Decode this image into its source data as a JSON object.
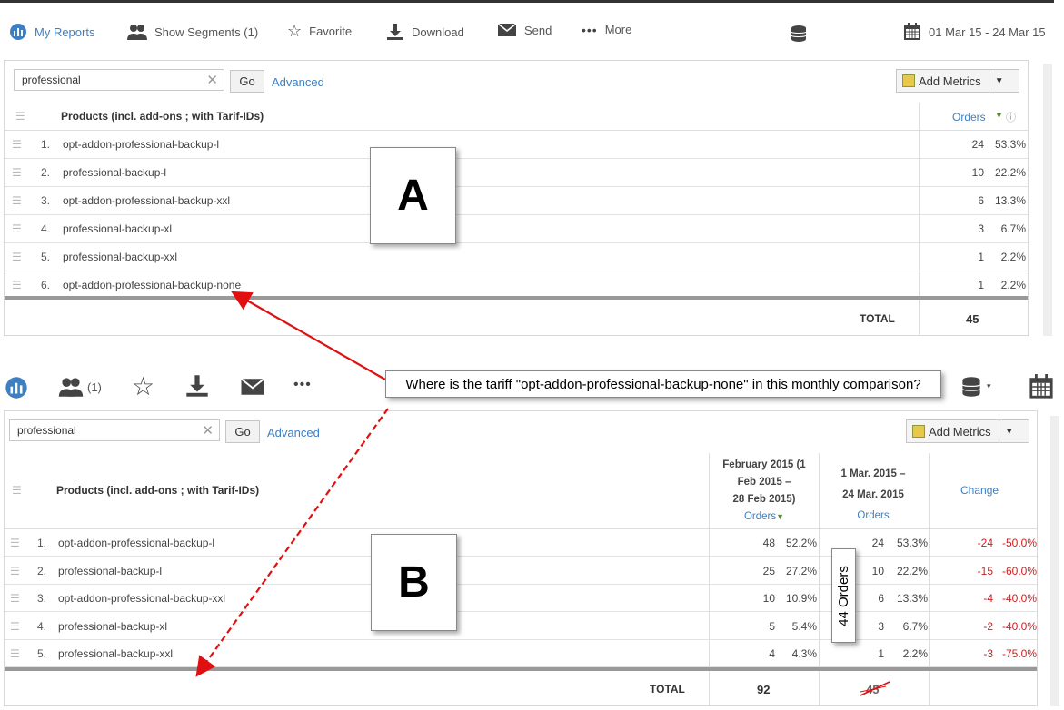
{
  "toolbar_a": {
    "my_reports": "My Reports",
    "show_segments": "Show Segments (1)",
    "favorite": "Favorite",
    "download": "Download",
    "send": "Send",
    "more": "More",
    "date_range": "01 Mar 15 - 24 Mar 15"
  },
  "panel_a": {
    "search_value": "professional",
    "go_label": "Go",
    "advanced_label": "Advanced",
    "add_metrics_label": "Add Metrics",
    "column_header": "Products (incl. add-ons ; with Tarif-IDs)",
    "metric_header": "Orders",
    "rows": [
      {
        "num": "1.",
        "name": "opt-addon-professional-backup-l",
        "orders": "24",
        "pct": "53.3%"
      },
      {
        "num": "2.",
        "name": "professional-backup-l",
        "orders": "10",
        "pct": "22.2%"
      },
      {
        "num": "3.",
        "name": "opt-addon-professional-backup-xxl",
        "orders": "6",
        "pct": "13.3%"
      },
      {
        "num": "4.",
        "name": "professional-backup-xl",
        "orders": "3",
        "pct": "6.7%"
      },
      {
        "num": "5.",
        "name": "professional-backup-xxl",
        "orders": "1",
        "pct": "2.2%"
      },
      {
        "num": "6.",
        "name": "opt-addon-professional-backup-none",
        "orders": "1",
        "pct": "2.2%"
      }
    ],
    "total_label": "TOTAL",
    "total_value": "45",
    "callout": "A"
  },
  "annotation": {
    "question": "Where is the tariff \"opt-addon-professional-backup-none\" in this monthly comparison?",
    "orders_note": "44 Orders",
    "color": "#e01010"
  },
  "toolbar_b": {
    "segments_count": "(1)"
  },
  "panel_b": {
    "search_value": "professional",
    "go_label": "Go",
    "advanced_label": "Advanced",
    "add_metrics_label": "Add Metrics",
    "column_header": "Products (incl. add-ons ; with Tarif-IDs)",
    "period1_line1": "February 2015 (1",
    "period1_line2": "Feb 2015 –",
    "period1_line3": "28 Feb 2015)",
    "period1_metric": "Orders",
    "period2_line1": "1 Mar. 2015 –",
    "period2_line2": "24 Mar. 2015",
    "period2_metric": "Orders",
    "change_header": "Change",
    "rows": [
      {
        "num": "1.",
        "name": "opt-addon-professional-backup-l",
        "feb": "48",
        "feb_pct": "52.2%",
        "mar": "24",
        "mar_pct": "53.3%",
        "chg": "-24",
        "chg_pct": "-50.0%"
      },
      {
        "num": "2.",
        "name": "professional-backup-l",
        "feb": "25",
        "feb_pct": "27.2%",
        "mar": "10",
        "mar_pct": "22.2%",
        "chg": "-15",
        "chg_pct": "-60.0%"
      },
      {
        "num": "3.",
        "name": "opt-addon-professional-backup-xxl",
        "feb": "10",
        "feb_pct": "10.9%",
        "mar": "6",
        "mar_pct": "13.3%",
        "chg": "-4",
        "chg_pct": "-40.0%"
      },
      {
        "num": "4.",
        "name": "professional-backup-xl",
        "feb": "5",
        "feb_pct": "5.4%",
        "mar": "3",
        "mar_pct": "6.7%",
        "chg": "-2",
        "chg_pct": "-40.0%"
      },
      {
        "num": "5.",
        "name": "professional-backup-xxl",
        "feb": "4",
        "feb_pct": "4.3%",
        "mar": "1",
        "mar_pct": "2.2%",
        "chg": "-3",
        "chg_pct": "-75.0%"
      }
    ],
    "total_label": "TOTAL",
    "total_feb": "92",
    "total_mar": "45",
    "callout": "B"
  }
}
